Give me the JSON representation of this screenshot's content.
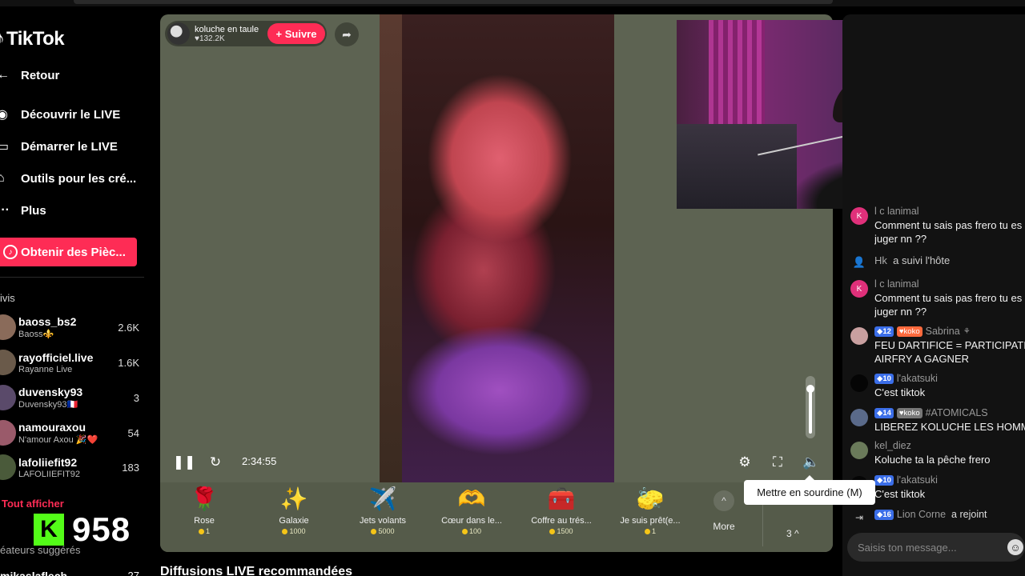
{
  "app": {
    "logo_text": "TikTok",
    "logo_icon": "tiktok-note-icon"
  },
  "nav": {
    "back": "Retour",
    "discover": "Découvrir le LIVE",
    "start": "Démarrer le LIVE",
    "tools": "Outils pour les cré...",
    "more": "Plus",
    "coins": "Obtenir des Pièc..."
  },
  "followed": {
    "label": "ivis",
    "items": [
      {
        "user": "baoss_bs2",
        "name": "Baoss⚜️",
        "count": "2.6K",
        "color": "#8a6b5a"
      },
      {
        "user": "rayofficiel.live",
        "name": "Rayanne Live",
        "count": "1.6K",
        "color": "#6a5a4a"
      },
      {
        "user": "duvensky93",
        "name": "Duvensky93🇫🇷",
        "count": "3",
        "color": "#5a4a6a"
      },
      {
        "user": "namouraxou",
        "name": "N'amour Axou 🎉❤️",
        "count": "54",
        "color": "#9a5a6a"
      },
      {
        "user": "lafoliiefit92",
        "name": "LAFOLIIEFIT92",
        "count": "183",
        "color": "#4a5a3a"
      }
    ],
    "show_all": "Tout afficher"
  },
  "creators": {
    "label": "éateurs suggérés",
    "first_user": "mikaslaflech...",
    "first_count": "27"
  },
  "overlay": {
    "kick_letter": "K",
    "viewers": "958"
  },
  "player": {
    "host_name": "koluche en taule",
    "host_likes": "♥132.2K",
    "follow_label": "+ Suivre",
    "time": "2:34:55",
    "volume_level": 0.85,
    "tooltip": "Mettre en sourdine (M)"
  },
  "gifts": [
    {
      "name": "Rose",
      "price": "1",
      "icon": "🌹"
    },
    {
      "name": "Galaxie",
      "price": "1000",
      "icon": "✨"
    },
    {
      "name": "Jets volants",
      "price": "5000",
      "icon": "✈️"
    },
    {
      "name": "Cœur dans le...",
      "price": "100",
      "icon": "🫶"
    },
    {
      "name": "Coffre au trés...",
      "price": "1500",
      "icon": "🧰"
    },
    {
      "name": "Je suis prêt(e...",
      "price": "1",
      "icon": "🧽"
    }
  ],
  "gift_bar": {
    "more_label": "More",
    "count_label": "3 ^"
  },
  "recommended_title": "Diffusions LIVE recommandées",
  "chat": {
    "messages": [
      {
        "kind": "msg",
        "user": "l c lanimal",
        "text1": "Comment tu sais pas frero tu es",
        "text2": "juger nn ??",
        "av_letter": "K",
        "av_color": "#e0307a"
      },
      {
        "kind": "sys",
        "user": "Hk",
        "action": "a suivi l'hôte"
      },
      {
        "kind": "msg",
        "user": "l c lanimal",
        "text1": "Comment tu sais pas frero tu es",
        "text2": "juger nn ??",
        "av_letter": "K",
        "av_color": "#e0307a"
      },
      {
        "kind": "msg",
        "user": "Sabrina",
        "level": "12",
        "fan": "koko",
        "text1": "FEU DARTIFICE = PARTICIPATIO",
        "text2": "AIRFRY A GAGNER",
        "av_color": "#c9a0a0"
      },
      {
        "kind": "msg",
        "user": "l'akatsuki",
        "level": "10",
        "text1": "C'est tiktok",
        "av_color": "#050505"
      },
      {
        "kind": "msg",
        "user": "#ATOMICALS",
        "level": "14",
        "fan": "koko",
        "text1": "LIBEREZ KOLUCHE LES HOMME",
        "av_color": "#5a6a8a"
      },
      {
        "kind": "msg",
        "user": "kel_diez",
        "text1": "Koluche ta la pêche frero",
        "av_color": "#6a7a5a"
      },
      {
        "kind": "msg",
        "user": "l'akatsuki",
        "level": "10",
        "text1": "C'est tiktok",
        "av_color": "#050505"
      },
      {
        "kind": "join",
        "user": "Lion Corne",
        "level": "16",
        "action": "a rejoint"
      }
    ],
    "input_placeholder": "Saisis ton message..."
  }
}
